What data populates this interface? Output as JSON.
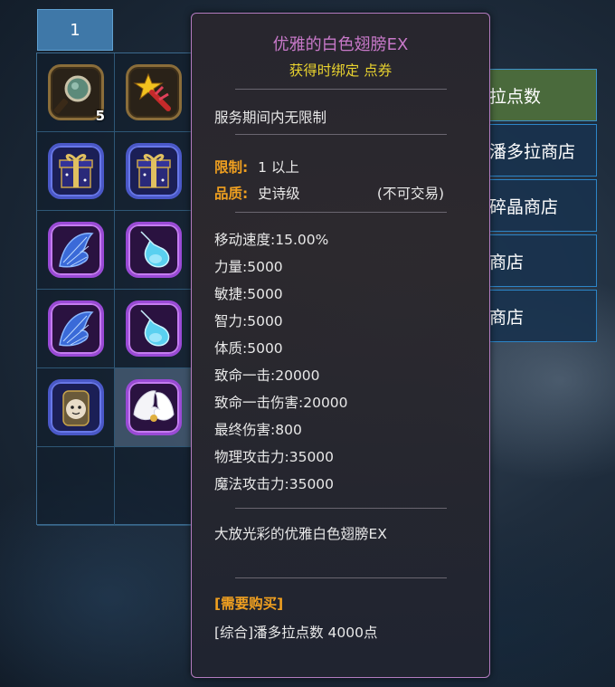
{
  "inventory": {
    "tab_label": "1",
    "slots": [
      {
        "icon": "magnifier-icon",
        "count": "5"
      },
      {
        "icon": "star-wand-icon",
        "count": ""
      },
      {
        "icon": "gift-box-icon",
        "count": ""
      },
      {
        "icon": "gift-box-icon",
        "count": ""
      },
      {
        "icon": "blue-wing-icon",
        "count": ""
      },
      {
        "icon": "potion-icon",
        "count": ""
      },
      {
        "icon": "blue-wing-icon",
        "count": ""
      },
      {
        "icon": "potion-icon",
        "count": ""
      },
      {
        "icon": "pet-egg-icon",
        "count": ""
      },
      {
        "icon": "white-wing-icon",
        "count": ""
      }
    ]
  },
  "menu": {
    "items": [
      "拉点数",
      "潘多拉商店",
      "碎晶商店",
      "商店",
      "商店"
    ]
  },
  "tooltip": {
    "title": "优雅的白色翅膀EX",
    "subtitle": "获得时绑定 点券",
    "duration": "服务期间内无限制",
    "limit_label": "限制:",
    "limit_value": "1 以上",
    "quality_label": "品质:",
    "quality_value": "史诗级",
    "trade_note": "(不可交易)",
    "stats": [
      "移动速度:15.00%",
      "力量:5000",
      "敏捷:5000",
      "智力:5000",
      "体质:5000",
      "致命一击:20000",
      "致命一击伤害:20000",
      "最终伤害:800",
      "物理攻击力:35000",
      "魔法攻击力:35000"
    ],
    "description": "大放光彩的优雅白色翅膀EX",
    "purchase_label": "[需要购买]",
    "purchase_value": "[综合]潘多拉点数 4000点"
  },
  "colors": {
    "title": "#c778c8",
    "subtitle": "#e8d22e",
    "label": "#f0a020",
    "tooltip_border": "#b37bbf",
    "menu_active": "#4a6a3c",
    "menu_border": "#2c85c8"
  }
}
